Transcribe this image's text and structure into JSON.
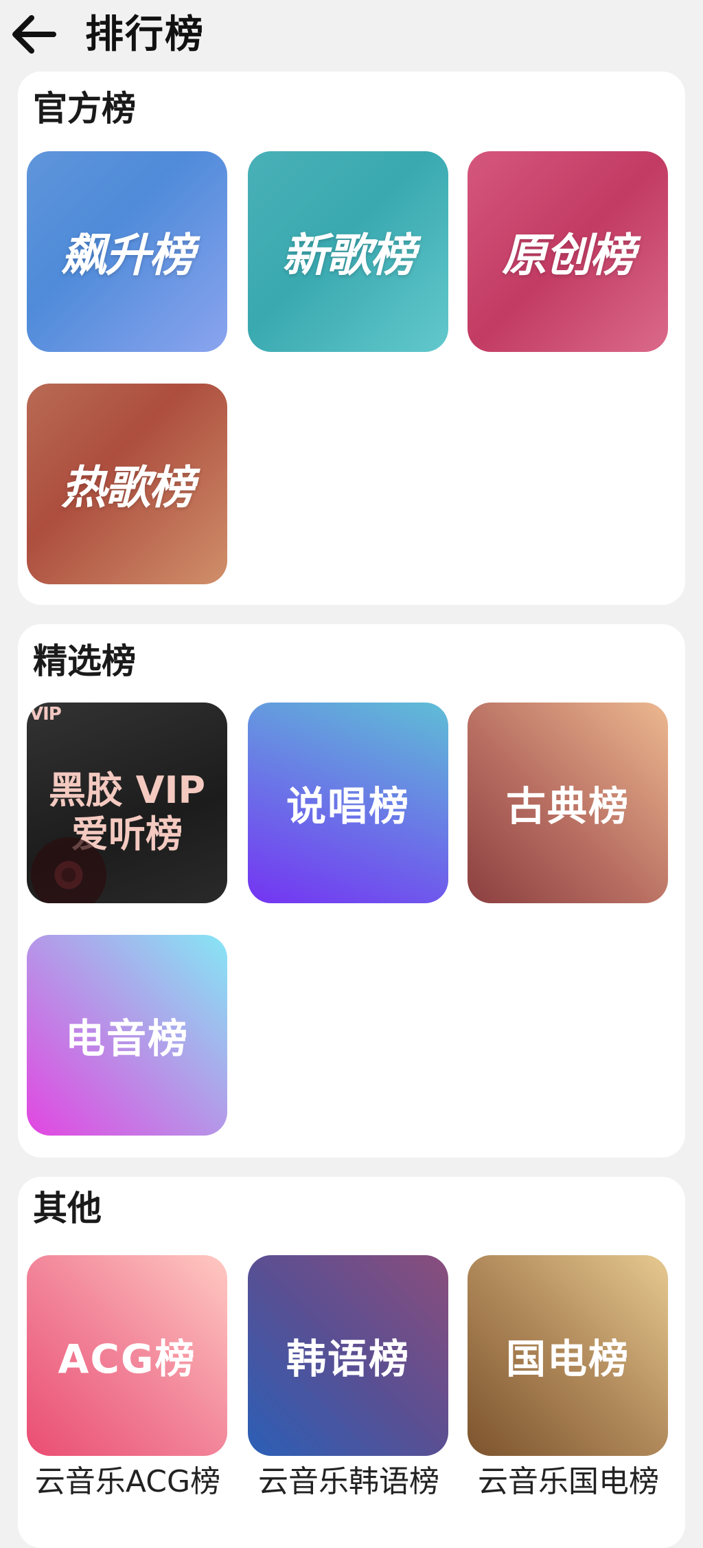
{
  "header": {
    "title": "排行榜",
    "back_icon": "arrow-left-icon"
  },
  "sections": [
    {
      "title": "官方榜",
      "tiles": [
        {
          "label": "飙升榜",
          "gradient": [
            "#4f8fd6",
            "#8aa6ee"
          ]
        },
        {
          "label": "新歌榜",
          "gradient": [
            "#3aa9b0",
            "#5cc8cc"
          ]
        },
        {
          "label": "原创榜",
          "gradient": [
            "#c23b63",
            "#db6a8a"
          ]
        },
        {
          "label": "热歌榜",
          "gradient": [
            "#ad4e3f",
            "#d08f6a"
          ]
        }
      ]
    },
    {
      "title": "精选榜",
      "tiles": [
        {
          "label": "黑胶VIP爱听榜",
          "badge": "VIP",
          "line1": "黑胶 VIP",
          "line2": "爱听榜",
          "gradient": [
            "#2a2a2a",
            "#1a1a1a"
          ]
        },
        {
          "label": "说唱榜",
          "gradient": [
            "#7536f2",
            "#5bc0d8"
          ]
        },
        {
          "label": "古典榜",
          "gradient": [
            "#8c3f40",
            "#e8b58e"
          ]
        },
        {
          "label": "电音榜",
          "gradient": [
            "#e246e0",
            "#86e6f5"
          ]
        }
      ]
    },
    {
      "title": "其他",
      "tiles": [
        {
          "label": "ACG榜",
          "caption": "云音乐ACG榜",
          "gradient": [
            "#ea4d72",
            "#ffc9c2"
          ]
        },
        {
          "label": "韩语榜",
          "caption": "云音乐韩语榜",
          "gradient": [
            "#2b5fb6",
            "#8a4e7c"
          ]
        },
        {
          "label": "国电榜",
          "caption": "云音乐国电榜",
          "gradient": [
            "#7c532d",
            "#e6c990"
          ]
        }
      ]
    }
  ]
}
